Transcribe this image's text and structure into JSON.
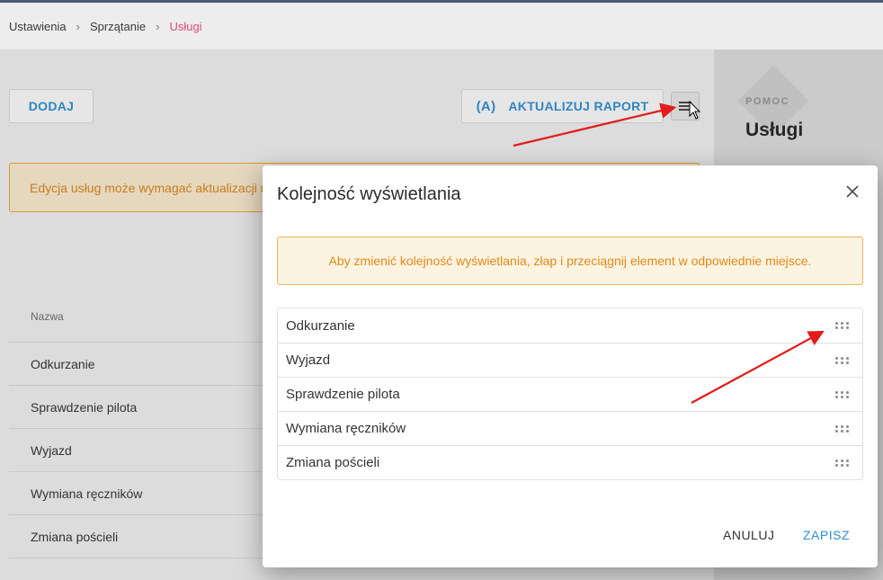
{
  "breadcrumb": [
    "Ustawienia",
    "Sprzątanie",
    "Usługi"
  ],
  "toolbar": {
    "add_label": "DODAJ",
    "report_label": "AKTUALIZUJ RAPORT",
    "report_icon": "broadcast-tower-icon",
    "order_icon": "list-menu-icon"
  },
  "warning_text": "Edycja usług może wymagać aktualizacji raportu.",
  "table": {
    "header": "Nazwa",
    "rows": [
      "Odkurzanie",
      "Sprawdzenie pilota",
      "Wyjazd",
      "Wymiana ręczników",
      "Zmiana pościeli"
    ]
  },
  "help": {
    "label": "POMOC",
    "title": "Usługi"
  },
  "modal": {
    "title": "Kolejność wyświetlania",
    "info": "Aby zmienić kolejność wyświetlania, złap i przeciągnij element w odpowiednie miejsce.",
    "items": [
      "Odkurzanie",
      "Wyjazd",
      "Sprawdzenie pilota",
      "Wymiana ręczników",
      "Zmiana pościeli"
    ],
    "cancel_label": "ANULUJ",
    "save_label": "ZAPISZ"
  },
  "colors": {
    "accent": "#2f86c2",
    "breadcrumb_active": "#e04a7a",
    "warning": "#e08a1a",
    "annotation_arrow": "#e41b1b"
  }
}
